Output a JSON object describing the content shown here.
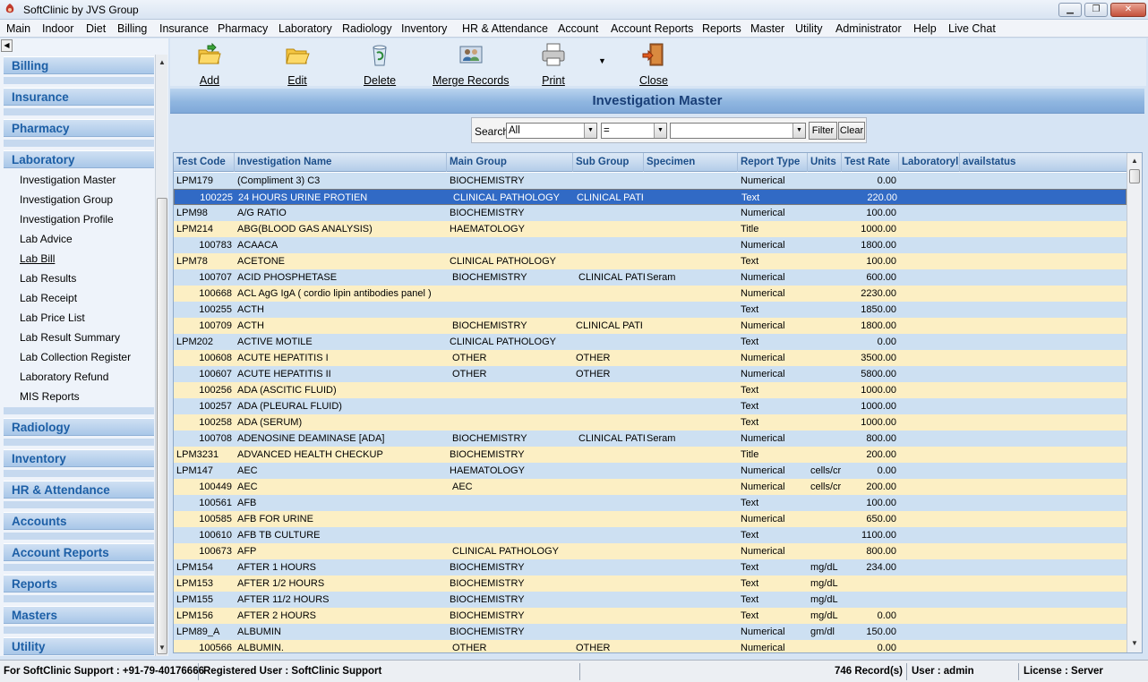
{
  "window": {
    "title": "SoftClinic by JVS Group",
    "minimize": "▁",
    "restore": "❐",
    "close": "✕"
  },
  "menu": [
    "Main",
    "Indoor",
    "Diet",
    "Billing",
    "Insurance",
    "Pharmacy",
    "Laboratory",
    "Radiology",
    "Inventory",
    "HR & Attendance",
    "Account",
    "Account Reports",
    "Reports",
    "Master",
    "Utility",
    "Administrator",
    "Help",
    "Live Chat"
  ],
  "sidebar": {
    "sections_top": [
      "Billing",
      "Insurance",
      "Pharmacy",
      "Laboratory"
    ],
    "laboratory_items": [
      "Investigation Master",
      "Investigation Group",
      "Investigation Profile",
      "Lab Advice",
      "Lab Bill",
      "Lab Results",
      "Lab Receipt",
      "Lab Price List",
      "Lab Result Summary",
      "Lab Collection Register",
      "Laboratory Refund",
      "MIS Reports"
    ],
    "sections_bottom": [
      "Radiology",
      "Inventory",
      "HR & Attendance",
      "Accounts",
      "Account Reports",
      "Reports",
      "Masters",
      "Utility"
    ]
  },
  "toolbar": {
    "add": "Add",
    "edit": "Edit",
    "delete": "Delete",
    "merge": "Merge Records",
    "print": "Print",
    "close": "Close"
  },
  "form_title": "Investigation Master",
  "search": {
    "label": "Search",
    "field_value": "All",
    "operator_value": "=",
    "text_value": "",
    "filter_label": "Filter",
    "clear_label": "Clear"
  },
  "grid": {
    "columns": [
      "Test Code",
      "Investigation Name",
      "Main Group",
      "Sub Group",
      "Specimen",
      "Report Type",
      "Units",
      "Test Rate",
      "Laboratoryl",
      "availstatus"
    ],
    "rows": [
      [
        "LPM179",
        "(Compliment 3) C3",
        "BIOCHEMISTRY",
        "",
        "",
        "Numerical",
        "",
        "0.00"
      ],
      [
        "100225",
        "24 HOURS URINE PROTIEN",
        "CLINICAL PATHOLOGY",
        "CLINICAL PATH",
        "",
        "Text",
        "",
        "220.00"
      ],
      [
        "LPM98",
        "A/G RATIO",
        "BIOCHEMISTRY",
        "",
        "",
        "Numerical",
        "",
        "100.00"
      ],
      [
        "LPM214",
        "ABG(BLOOD GAS ANALYSIS)",
        "HAEMATOLOGY",
        "",
        "",
        "Title",
        "",
        "1000.00"
      ],
      [
        "100783",
        "ACAACA",
        "",
        "",
        "",
        "Numerical",
        "",
        "1800.00"
      ],
      [
        "LPM78",
        "ACETONE",
        "CLINICAL PATHOLOGY",
        "",
        "",
        "Text",
        "",
        "100.00"
      ],
      [
        "100707",
        "ACID PHOSPHETASE",
        "BIOCHEMISTRY",
        "CLINICAL PATH",
        "Seram",
        "Numerical",
        "",
        "600.00"
      ],
      [
        "100668",
        "ACL AgG IgA ( cordio lipin antibodies panel )",
        "",
        "",
        "",
        "Numerical",
        "",
        "2230.00"
      ],
      [
        "100255",
        "ACTH",
        "",
        "",
        "",
        "Text",
        "",
        "1850.00"
      ],
      [
        "100709",
        "ACTH",
        "BIOCHEMISTRY",
        "CLINICAL PATH",
        "",
        "Numerical",
        "",
        "1800.00"
      ],
      [
        "LPM202",
        "ACTIVE MOTILE",
        "CLINICAL PATHOLOGY",
        "",
        "",
        "Text",
        "",
        "0.00"
      ],
      [
        "100608",
        "ACUTE HEPATITIS I",
        "OTHER",
        "OTHER",
        "",
        "Numerical",
        "",
        "3500.00"
      ],
      [
        "100607",
        "ACUTE HEPATITIS II",
        "OTHER",
        "OTHER",
        "",
        "Numerical",
        "",
        "5800.00"
      ],
      [
        "100256",
        "ADA (ASCITIC FLUID)",
        "",
        "",
        "",
        "Text",
        "",
        "1000.00"
      ],
      [
        "100257",
        "ADA (PLEURAL FLUID)",
        "",
        "",
        "",
        "Text",
        "",
        "1000.00"
      ],
      [
        "100258",
        "ADA (SERUM)",
        "",
        "",
        "",
        "Text",
        "",
        "1000.00"
      ],
      [
        "100708",
        "ADENOSINE DEAMINASE [ADA]",
        "BIOCHEMISTRY",
        "CLINICAL PATH",
        "Seram",
        "Numerical",
        "",
        "800.00"
      ],
      [
        "LPM3231",
        "ADVANCED HEALTH CHECKUP",
        "BIOCHEMISTRY",
        "",
        "",
        "Title",
        "",
        "200.00"
      ],
      [
        "LPM147",
        "AEC",
        "HAEMATOLOGY",
        "",
        "",
        "Numerical",
        "cells/cr",
        "0.00"
      ],
      [
        "100449",
        "AEC",
        "AEC",
        "",
        "",
        "Numerical",
        "cells/cr",
        "200.00"
      ],
      [
        "100561",
        "AFB",
        "",
        "",
        "",
        "Text",
        "",
        "100.00"
      ],
      [
        "100585",
        "AFB FOR URINE",
        "",
        "",
        "",
        "Numerical",
        "",
        "650.00"
      ],
      [
        "100610",
        "AFB TB CULTURE",
        "",
        "",
        "",
        "Text",
        "",
        "1100.00"
      ],
      [
        "100673",
        "AFP",
        "CLINICAL PATHOLOGY",
        "",
        "",
        "Numerical",
        "",
        "800.00"
      ],
      [
        "LPM154",
        "AFTER   1    HOURS",
        "BIOCHEMISTRY",
        "",
        "",
        "Text",
        "mg/dL",
        "234.00"
      ],
      [
        "LPM153",
        "AFTER   1/2    HOURS",
        "BIOCHEMISTRY",
        "",
        "",
        "Text",
        "mg/dL",
        ""
      ],
      [
        "LPM155",
        "AFTER   11/2    HOURS",
        "BIOCHEMISTRY",
        "",
        "",
        "Text",
        "mg/dL",
        ""
      ],
      [
        "LPM156",
        "AFTER   2    HOURS",
        "BIOCHEMISTRY",
        "",
        "",
        "Text",
        "mg/dL",
        "0.00"
      ],
      [
        "LPM89_A",
        "ALBUMIN",
        "BIOCHEMISTRY",
        "",
        "",
        "Numerical",
        "gm/dl",
        "150.00"
      ],
      [
        "100566",
        "ALBUMIN.",
        "OTHER",
        "OTHER",
        "",
        "Numerical",
        "",
        "0.00"
      ]
    ],
    "selected_row": 1
  },
  "status": {
    "support": "For SoftClinic Support : +91-79-40176666",
    "registered": "Registered User : SoftClinic Support",
    "records": "746 Record(s)",
    "user": "User : admin",
    "license": "License : Server"
  }
}
